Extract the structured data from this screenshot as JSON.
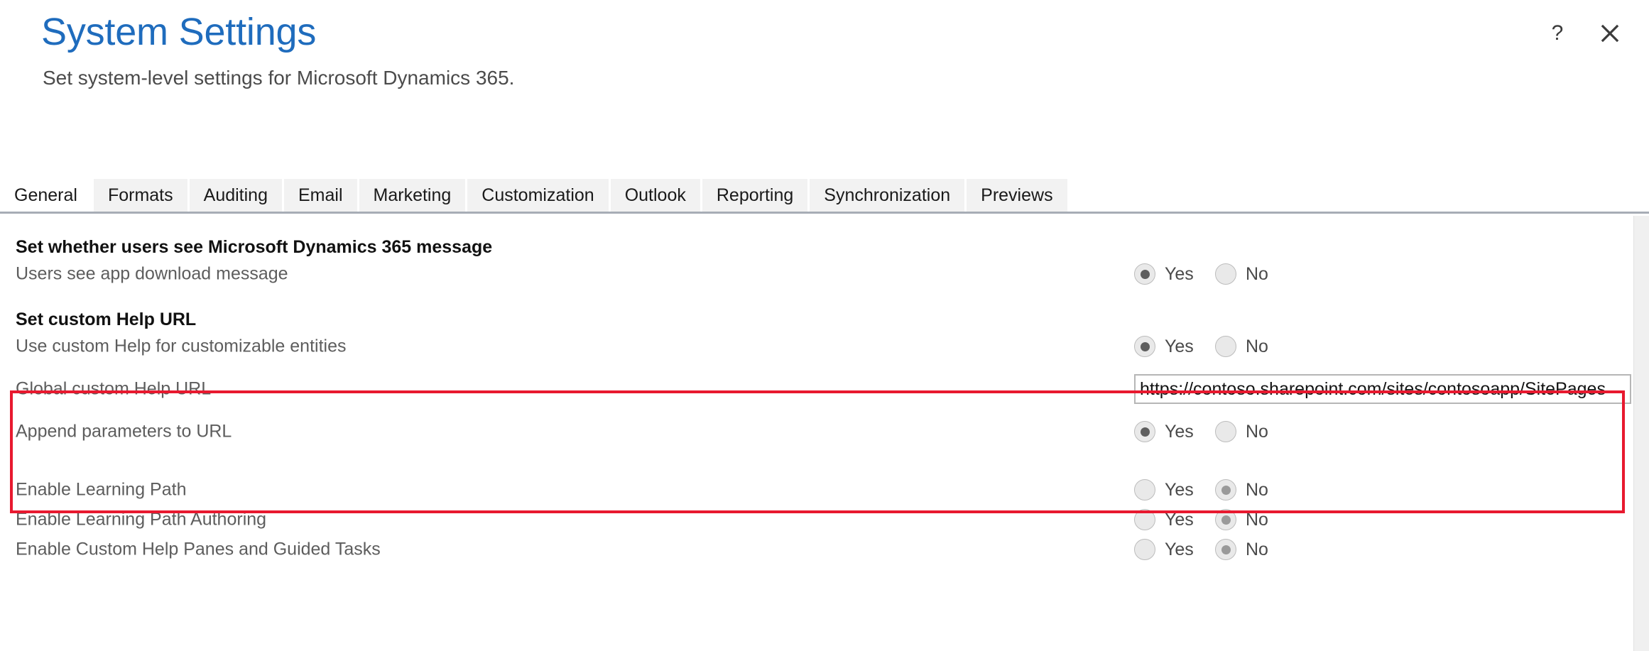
{
  "header": {
    "title": "System Settings",
    "subtitle": "Set system-level settings for Microsoft Dynamics 365.",
    "help_icon": "question-mark-icon",
    "help_label": "?",
    "close_icon": "close-icon",
    "title_color": "#1f6cbd"
  },
  "tabs": [
    {
      "label": "General",
      "active": true
    },
    {
      "label": "Formats",
      "active": false
    },
    {
      "label": "Auditing",
      "active": false
    },
    {
      "label": "Email",
      "active": false
    },
    {
      "label": "Marketing",
      "active": false
    },
    {
      "label": "Customization",
      "active": false
    },
    {
      "label": "Outlook",
      "active": false
    },
    {
      "label": "Reporting",
      "active": false
    },
    {
      "label": "Synchronization",
      "active": false
    },
    {
      "label": "Previews",
      "active": false
    }
  ],
  "sections": [
    {
      "heading": "Set whether users see Microsoft Dynamics 365 message"
    },
    {
      "heading": "Set custom Help URL"
    }
  ],
  "radio_labels": {
    "yes": "Yes",
    "no": "No"
  },
  "rows": [
    {
      "label": "Users see app download message",
      "type": "radio",
      "selected": "yes"
    },
    {
      "label": "Use custom Help for customizable entities",
      "type": "radio",
      "selected": "yes"
    },
    {
      "label": "Global custom Help URL",
      "type": "text",
      "value": "https://contoso.sharepoint.com/sites/contosoapp/SitePages",
      "placeholder": ""
    },
    {
      "label": "Append parameters to URL",
      "type": "radio",
      "selected": "yes"
    },
    {
      "label": "Enable Learning Path",
      "type": "radio",
      "selected": "no"
    },
    {
      "label": "Enable Learning Path Authoring",
      "type": "radio",
      "selected": "no"
    },
    {
      "label": "Enable Custom Help Panes and Guided Tasks",
      "type": "radio",
      "selected": "no"
    }
  ],
  "highlight": {
    "color": "#e8192f"
  }
}
